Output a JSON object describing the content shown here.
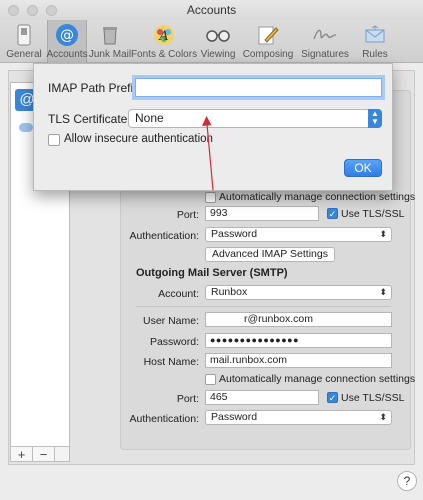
{
  "window": {
    "title": "Accounts"
  },
  "toolbar": {
    "items": [
      {
        "label": "General",
        "icon": "switch-icon"
      },
      {
        "label": "Accounts",
        "icon": "at-sign-icon"
      },
      {
        "label": "Junk Mail",
        "icon": "trash-icon"
      },
      {
        "label": "Fonts & Colors",
        "icon": "font-palette-icon"
      },
      {
        "label": "Viewing",
        "icon": "glasses-icon"
      },
      {
        "label": "Composing",
        "icon": "pencil-paper-icon"
      },
      {
        "label": "Signatures",
        "icon": "signature-icon"
      },
      {
        "label": "Rules",
        "icon": "envelope-rules-icon"
      }
    ],
    "selected": "Accounts"
  },
  "sheet": {
    "imap_path_prefix_label": "IMAP Path Prefix:",
    "imap_path_prefix_value": "",
    "tls_certificate_label": "TLS Certificate:",
    "tls_certificate_value": "None",
    "allow_insecure_label": "Allow insecure authentication",
    "ok_label": "OK"
  },
  "incoming": {
    "auto_manage_label": "Automatically manage connection settings",
    "port_label": "Port:",
    "port_value": "993",
    "use_tls_label": "Use TLS/SSL",
    "authentication_label": "Authentication:",
    "authentication_value": "Password",
    "advanced_button": "Advanced IMAP Settings"
  },
  "outgoing": {
    "section_title": "Outgoing Mail Server (SMTP)",
    "account_label": "Account:",
    "account_value": "Runbox",
    "username_label": "User Name:",
    "username_value": "r@runbox.com",
    "password_label": "Password:",
    "password_value": "●●●●●●●●●●●●●●●",
    "hostname_label": "Host Name:",
    "hostname_value": "mail.runbox.com",
    "auto_manage_label": "Automatically manage connection settings",
    "port_label": "Port:",
    "port_value": "465",
    "use_tls_label": "Use TLS/SSL",
    "authentication_label": "Authentication:",
    "authentication_value": "Password"
  },
  "list_buttons": {
    "add": "+",
    "remove": "−"
  },
  "help": {
    "label": "?"
  },
  "colors": {
    "accent": "#3a87d9",
    "arrow": "#d0293b"
  }
}
